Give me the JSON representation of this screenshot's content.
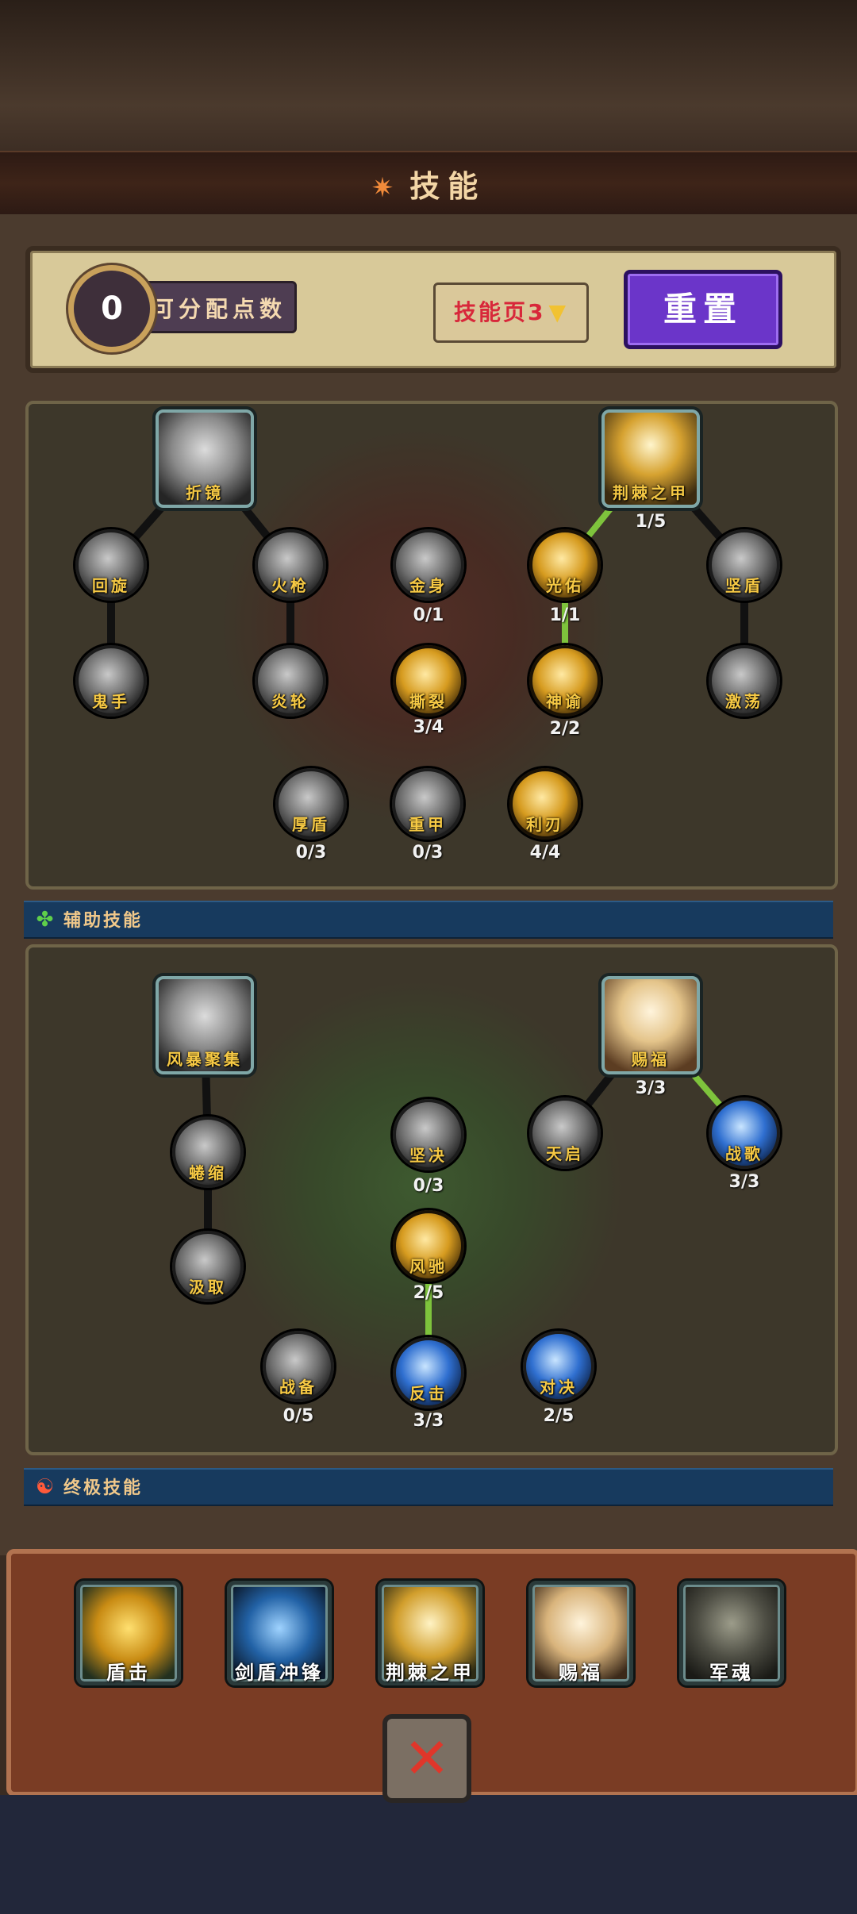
{
  "title": "技能",
  "points": {
    "value": "0",
    "label": "可分配点数"
  },
  "page_selector": {
    "label": "技能页3"
  },
  "reset_label": "重置",
  "tree1": {
    "nodes": [
      {
        "label": "折镜",
        "count": ""
      },
      {
        "label": "回旋",
        "count": ""
      },
      {
        "label": "火枪",
        "count": ""
      },
      {
        "label": "鬼手",
        "count": ""
      },
      {
        "label": "炎轮",
        "count": ""
      },
      {
        "label": "金身",
        "count": "0/1"
      },
      {
        "label": "撕裂",
        "count": "3/4"
      },
      {
        "label": "荆棘之甲",
        "count": "1/5"
      },
      {
        "label": "光佑",
        "count": "1/1"
      },
      {
        "label": "坚盾",
        "count": ""
      },
      {
        "label": "神谕",
        "count": "2/2"
      },
      {
        "label": "激荡",
        "count": ""
      },
      {
        "label": "厚盾",
        "count": "0/3"
      },
      {
        "label": "重甲",
        "count": "0/3"
      },
      {
        "label": "利刃",
        "count": "4/4"
      }
    ]
  },
  "section_support": {
    "label": "辅助技能"
  },
  "tree2": {
    "nodes": [
      {
        "label": "风暴聚集",
        "count": ""
      },
      {
        "label": "蜷缩",
        "count": ""
      },
      {
        "label": "汲取",
        "count": ""
      },
      {
        "label": "坚决",
        "count": "0/3"
      },
      {
        "label": "风驰",
        "count": "2/5"
      },
      {
        "label": "赐福",
        "count": "3/3"
      },
      {
        "label": "天启",
        "count": ""
      },
      {
        "label": "战歌",
        "count": "3/3"
      },
      {
        "label": "战备",
        "count": "0/5"
      },
      {
        "label": "反击",
        "count": "3/3"
      },
      {
        "label": "对决",
        "count": "2/5"
      }
    ]
  },
  "section_ultimate": {
    "label": "终极技能"
  },
  "ultimates": [
    {
      "label": "盾击"
    },
    {
      "label": "剑盾冲锋"
    },
    {
      "label": "荆棘之甲"
    },
    {
      "label": "赐福"
    },
    {
      "label": "军魂"
    }
  ]
}
